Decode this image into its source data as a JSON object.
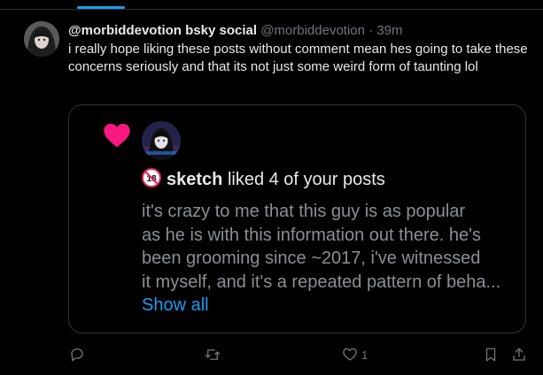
{
  "post": {
    "display_name": "@morbiddevotion bsky social",
    "handle": "@morbiddevotion",
    "separator": "·",
    "time": "39m",
    "text": "i really hope liking these posts without comment mean hes going to take these concerns seriously and that its not just some weird form of taunting lol"
  },
  "quote": {
    "liker_name": "sketch",
    "liker_action": "liked 4 of your posts",
    "liker_badge_icon": "no-under-18-icon",
    "notification_icon": "heart-icon",
    "heart_color": "#f91880",
    "preview_lines": [
      "it's crazy to me that this guy is as popular",
      "as he is with this information out there. he's",
      "been grooming since ~2017, i've witnessed",
      "it myself, and it's a repeated pattern of beha..."
    ],
    "show_all_label": "Show all"
  },
  "actions": {
    "reply_icon": "reply-icon",
    "repost_icon": "repost-icon",
    "like_icon": "like-icon",
    "like_count": "1",
    "bookmark_icon": "bookmark-icon",
    "share_icon": "share-icon"
  },
  "colors": {
    "accent": "#1d9bf0",
    "background": "#000000",
    "secondary_text": "#71767b",
    "border": "#2f3336"
  }
}
